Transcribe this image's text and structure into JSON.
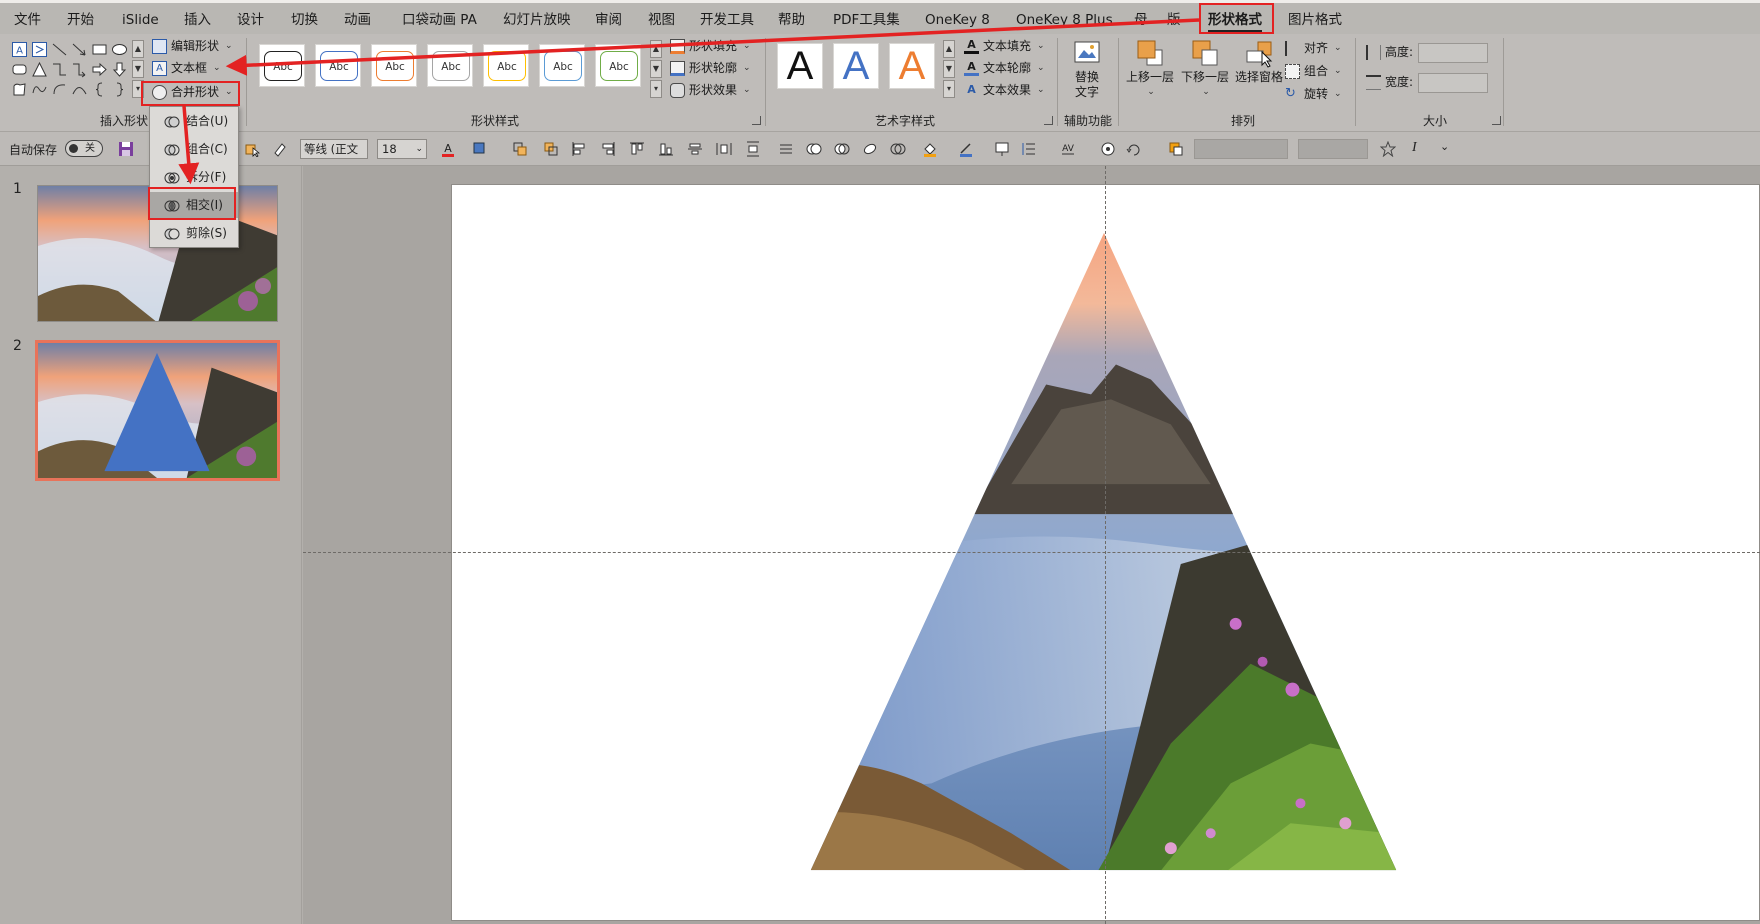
{
  "ribbon_tabs": [
    {
      "label": "文件",
      "active": false
    },
    {
      "label": "开始",
      "active": false
    },
    {
      "label": "iSlide",
      "active": false
    },
    {
      "label": "插入",
      "active": false
    },
    {
      "label": "设计",
      "active": false
    },
    {
      "label": "切换",
      "active": false
    },
    {
      "label": "动画",
      "active": false
    },
    {
      "label": "口袋动画 PA",
      "active": false
    },
    {
      "label": "幻灯片放映",
      "active": false
    },
    {
      "label": "审阅",
      "active": false
    },
    {
      "label": "视图",
      "active": false
    },
    {
      "label": "开发工具",
      "active": false
    },
    {
      "label": "帮助",
      "active": false
    },
    {
      "label": "PDF工具集",
      "active": false
    },
    {
      "label": "OneKey 8",
      "active": false
    },
    {
      "label": "OneKey 8 Plus",
      "active": false
    },
    {
      "label": "母",
      "active": false
    },
    {
      "label": "版",
      "active": false
    },
    {
      "label": "形状格式",
      "active": true
    },
    {
      "label": "图片格式",
      "active": false
    }
  ],
  "insert_shapes": {
    "edit_shape": "编辑形状",
    "text_box": "文本框",
    "merge_shapes": "合并形状",
    "group_label": "插入形状"
  },
  "shape_styles": {
    "samples": [
      "Abc",
      "Abc",
      "Abc",
      "Abc",
      "Abc",
      "Abc",
      "Abc"
    ],
    "sample_colors": [
      "#222222",
      "#4472c4",
      "#ed7d31",
      "#a5a5a5",
      "#ffc000",
      "#5b9bd5",
      "#70ad47"
    ],
    "fill": "形状填充",
    "outline": "形状轮廓",
    "effects": "形状效果",
    "group_label": "形状样式"
  },
  "wordart": {
    "samples": [
      "A",
      "A",
      "A"
    ],
    "sample_colors": [
      "#111111",
      "#4472c4",
      "#ed7d31"
    ],
    "text_fill": "文本填充",
    "text_outline": "文本轮廓",
    "text_effects": "文本效果",
    "group_label": "艺术字样式"
  },
  "accessibility": {
    "alt_text_line1": "替换",
    "alt_text_line2": "文字",
    "group_label": "辅助功能"
  },
  "arrange": {
    "bring_forward": "上移一层",
    "send_backward": "下移一层",
    "selection_pane": "选择窗格",
    "align": "对齐",
    "group": "组合",
    "rotate": "旋转",
    "group_label": "排列"
  },
  "size": {
    "height_label": "高度:",
    "width_label": "宽度:",
    "group_label": "大小"
  },
  "qat": {
    "autosave_label": "自动保存",
    "toggle_state": "关",
    "font_name": "等线 (正文",
    "font_size": "18"
  },
  "merge_menu": {
    "items": [
      {
        "label": "结合(U)",
        "selected": false
      },
      {
        "label": "组合(C)",
        "selected": false
      },
      {
        "label": "拆分(F)",
        "selected": false
      },
      {
        "label": "相交(I)",
        "selected": true
      },
      {
        "label": "剪除(S)",
        "selected": false
      }
    ]
  },
  "slides": [
    {
      "number": "1",
      "selected": false
    },
    {
      "number": "2",
      "selected": true
    }
  ],
  "colors": {
    "highlight_red": "#e32222",
    "selected_thumb_border": "#e8735a",
    "triangle_blue": "#4472c4"
  }
}
